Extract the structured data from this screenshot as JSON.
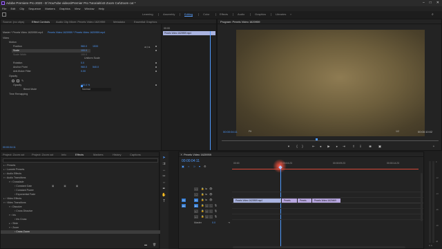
{
  "window": {
    "title": "Adobe Premiere Pro 2020 - D:\\YouTube videos\\Premier Pro Tutorials\\43 Zoom Cut\\Zoom cut *"
  },
  "menu": [
    "File",
    "Edit",
    "Clip",
    "Sequence",
    "Markers",
    "Graphics",
    "View",
    "Window",
    "Help"
  ],
  "workspaces": [
    "Learning",
    "Assembly",
    "Editing",
    "Color",
    "Effects",
    "Audio",
    "Graphics",
    "Libraries"
  ],
  "active_workspace": "Editing",
  "source_panel": {
    "tabs": [
      "Source: (no clips)",
      "Effect Controls",
      "Audio Clip Mixer: Pexels Video 1620959",
      "Metadata",
      "Essential Graphics"
    ],
    "header": "Master * Pexels Video 1620959.mp4",
    "header_seq": "Pexels Video 1620959 * Pexels Video 1620959.mp4",
    "mini_tc": "00:00",
    "mini_clip": "Pexels Video 1620959.mp4",
    "section_video": "Video",
    "motion": "Motion",
    "position_label": "Position",
    "position_x": "960.0",
    "position_y": "1533",
    "scale_label": "Scale",
    "scale_value": "100.0",
    "scale_width_label": "Scale Width",
    "scale_width_value": "100.0",
    "uniform_scale": "Uniform Scale",
    "rotation_label": "Rotation",
    "rotation_value": "0.0",
    "anchor_label": "Anchor Point",
    "anchor_x": "960.0",
    "anchor_y": "540.0",
    "flicker_label": "Anti-flicker Filter",
    "flicker_value": "0.00",
    "opacity": "Opacity",
    "opacity_label": "Opacity",
    "opacity_value": "100.0 %",
    "blend_label": "Blend Mode",
    "blend_value": "Normal",
    "time_remap": "Time Remapping",
    "footer_tc": "00:00:04:11"
  },
  "program": {
    "title": "Program: Pexels Video 1620959",
    "timecode": "00:00:04:11",
    "fit": "Fit",
    "quality": "1/2",
    "duration": "00:00:10:02"
  },
  "project": {
    "tabs": [
      "Project: Zoom cut",
      "Project: Zoom cut",
      "Info",
      "Effects",
      "Markers",
      "History",
      "Captions"
    ],
    "tree": [
      {
        "label": "Presets",
        "depth": 0
      },
      {
        "label": "Lumetri Presets",
        "depth": 0
      },
      {
        "label": "Audio Effects",
        "depth": 0
      },
      {
        "label": "Audio Transitions",
        "depth": 0
      },
      {
        "label": "Crossfade",
        "depth": 1
      },
      {
        "label": "Constant Gain",
        "depth": 2
      },
      {
        "label": "Constant Power",
        "depth": 2
      },
      {
        "label": "Exponential Fade",
        "depth": 2
      },
      {
        "label": "Video Effects",
        "depth": 0
      },
      {
        "label": "Video Transitions",
        "depth": 0
      },
      {
        "label": "Dissolve",
        "depth": 1
      },
      {
        "label": "Cross Dissolve",
        "depth": 2
      },
      {
        "label": "Iris",
        "depth": 1
      },
      {
        "label": "Iris Cross",
        "depth": 2
      },
      {
        "label": "Slide",
        "depth": 1
      },
      {
        "label": "Zoom",
        "depth": 1
      },
      {
        "label": "Cross Zoom",
        "depth": 2
      }
    ]
  },
  "timeline": {
    "tab": "Pexels Video 1620959",
    "timecode": "00:00:04:11",
    "ruler": [
      "00:00",
      "00:00:04:23",
      "00:00:09:23",
      "00:00:14:23"
    ],
    "tracks": [
      {
        "name": "V3",
        "muted": false,
        "kind": "video"
      },
      {
        "name": "V2",
        "muted": false,
        "kind": "video"
      },
      {
        "name": "V1",
        "muted": false,
        "kind": "video",
        "target": "V1"
      },
      {
        "name": "A1",
        "muted": true,
        "kind": "audio",
        "target": "A1"
      },
      {
        "name": "A2",
        "muted": true,
        "kind": "audio"
      },
      {
        "name": "A3",
        "muted": true,
        "kind": "audio"
      }
    ],
    "master_label": "Master",
    "master_value": "0.0",
    "clips": [
      {
        "label": "Pexels Video 1620959.mp4",
        "color": "#a9b3e0"
      },
      {
        "label": "Pexels",
        "color": "#b7a6e0"
      },
      {
        "label": "Pexels",
        "color": "#b7a6e0"
      },
      {
        "label": "Pexels Video 1620469",
        "color": "#b7a6e0"
      }
    ]
  },
  "colors": {
    "accent": "#4f9bff",
    "playhead": "#4f9bff",
    "workarea": "#d84a3a"
  }
}
